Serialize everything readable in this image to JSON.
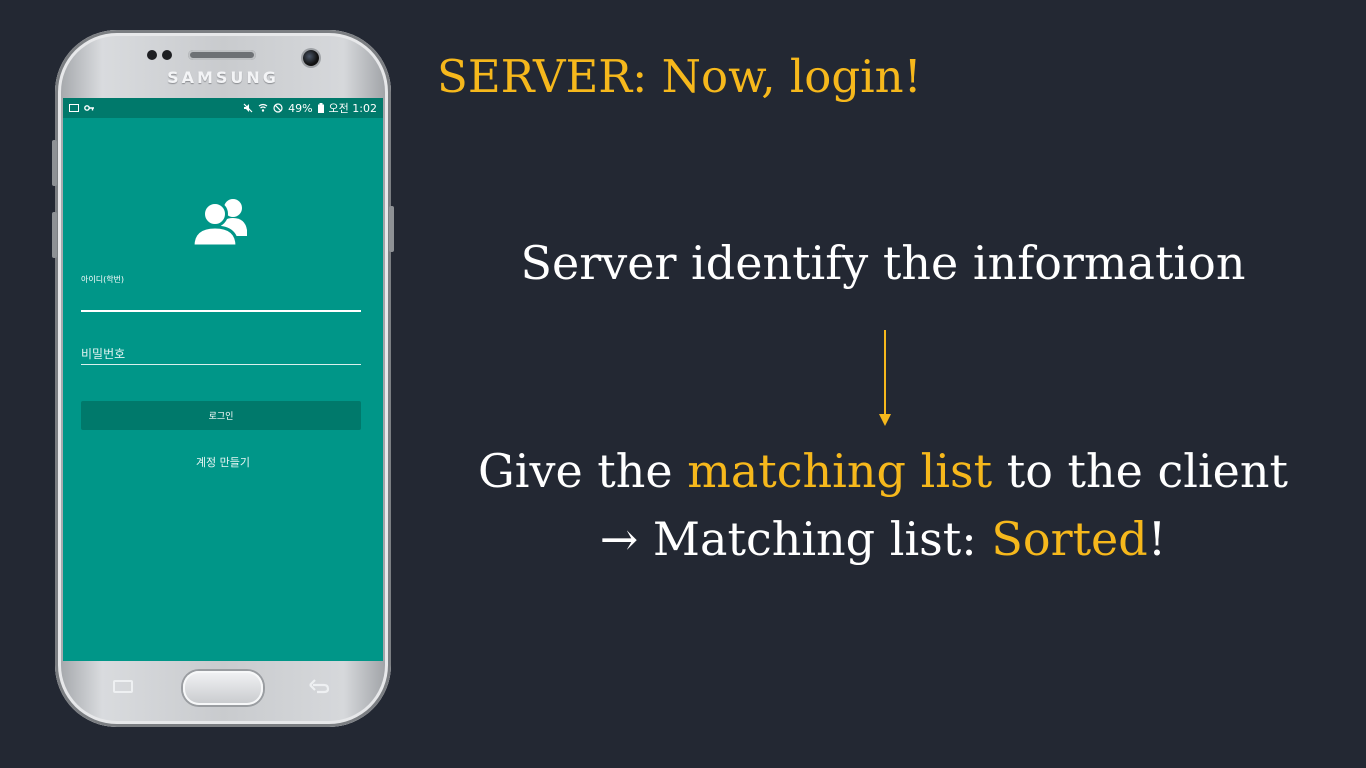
{
  "colors": {
    "background": "#232833",
    "accent": "#f6b81c",
    "text": "#ffffff",
    "app_primary": "#009688",
    "app_primary_dark": "#00796b"
  },
  "slide": {
    "title": "SERVER: Now, login!",
    "step1": "Server identify the information",
    "arrow_icon": "arrow-down-icon",
    "step2": {
      "pre": "Give the ",
      "highlight": "matching list",
      "post": " to the client"
    },
    "step3": {
      "pre": "→ Matching list: ",
      "highlight": "Sorted",
      "post": "!"
    }
  },
  "phone": {
    "brand": "SAMSUNG",
    "status_bar": {
      "battery": "49%",
      "time": "오전 1:02",
      "left_icons": [
        "image-icon",
        "key-icon"
      ],
      "right_icons": [
        "mute-icon",
        "wifi-icon",
        "block-icon",
        "battery-icon"
      ]
    },
    "app": {
      "icon": "users-icon",
      "id_label": "아이디(학번)",
      "id_value": "",
      "password_placeholder": "비밀번호",
      "login_button": "로그인",
      "signup_link": "계정 만들기"
    }
  }
}
